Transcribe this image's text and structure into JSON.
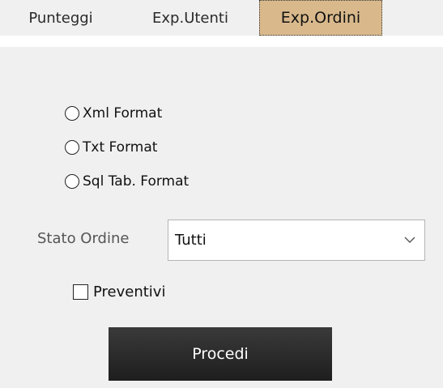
{
  "tabs": [
    {
      "label": "Punteggi"
    },
    {
      "label": "Exp.Utenti"
    },
    {
      "label": "Exp.Ordini",
      "active": true
    }
  ],
  "formats": [
    {
      "label": "Xml Format",
      "selected": false
    },
    {
      "label": "Txt Format",
      "selected": false
    },
    {
      "label": "Sql Tab. Format",
      "selected": false
    }
  ],
  "stato": {
    "label": "Stato Ordine",
    "selected": "Tutti"
  },
  "preventivi": {
    "label": "Preventivi",
    "checked": false
  },
  "action": {
    "label": "Procedi"
  },
  "colors": {
    "active_tab": "#d9b98c",
    "panel_bg": "#f0f0f0",
    "button_bg": "#262626"
  },
  "icons": {
    "select_arrow": "chevron-down-icon"
  }
}
